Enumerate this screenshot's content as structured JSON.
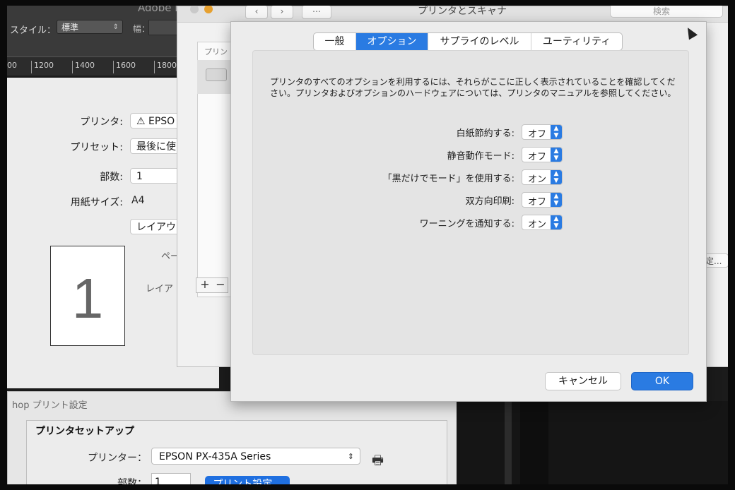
{
  "adobe": {
    "title": "Adobe I",
    "style_label": "スタイル：",
    "style_value": "標準",
    "width_label": "幅：",
    "ruler_ticks": [
      "00",
      "1200",
      "1400",
      "1600",
      "1800"
    ]
  },
  "print_dialog": {
    "printer_label": "プリンタ:",
    "printer_value": "⚠ EPSO",
    "preset_label": "プリセット:",
    "preset_value": "最後に使",
    "copies_label": "部数:",
    "copies_value": "1",
    "paper_label": "用紙サイズ:",
    "paper_value": "A4",
    "layout_popup": "レイアウ",
    "preview_number": "1",
    "pages_label": "ペー",
    "layout_label": "レイア"
  },
  "photoshop": {
    "window_title": "hop プリント設定",
    "group_title": "プリンタセットアップ",
    "printer_label": "プリンター：",
    "printer_value": "EPSON PX-435A Series",
    "copies_label": "部数：",
    "copies_value": "1",
    "print_settings_button": "プリント設定..."
  },
  "printers_window": {
    "title": "プリンタとスキャナ",
    "search_placeholder": "検索",
    "list_header": "プリン",
    "add_label": "+",
    "remove_label": "−",
    "behind_button": "定..."
  },
  "options_sheet": {
    "tabs": [
      {
        "label": "一般",
        "active": false
      },
      {
        "label": "オプション",
        "active": true
      },
      {
        "label": "サプライのレベル",
        "active": false
      },
      {
        "label": "ユーティリティ",
        "active": false
      }
    ],
    "description": "プリンタのすべてのオプションを利用するには、それらがここに正しく表示されていることを確認してください。プリンタおよびオプションのハードウェアについては、プリンタのマニュアルを参照してください。",
    "options": [
      {
        "label": "白紙節約する:",
        "value": "オフ"
      },
      {
        "label": "静音動作モード:",
        "value": "オフ"
      },
      {
        "label": "「黒だけでモード」を使用する:",
        "value": "オン"
      },
      {
        "label": "双方向印刷:",
        "value": "オフ"
      },
      {
        "label": "ワーニングを通知する:",
        "value": "オン"
      }
    ],
    "cancel_label": "キャンセル",
    "ok_label": "OK"
  },
  "colors": {
    "accent": "#2a7be2",
    "window_bg": "#ececec",
    "dark_bg": "#1b1b1b"
  }
}
